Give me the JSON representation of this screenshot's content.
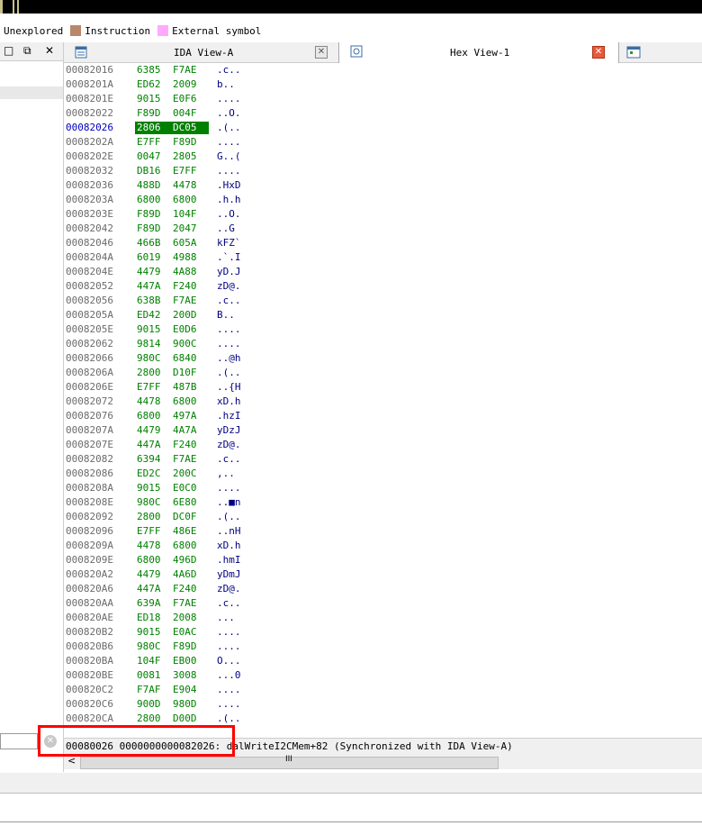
{
  "legend": [
    {
      "label": "Unexplored",
      "color": ""
    },
    {
      "label": "Instruction",
      "color": "#b9876a"
    },
    {
      "label": "External symbol",
      "color": "#ffaaff"
    }
  ],
  "left_panel": {
    "icons": [
      "restore-icon",
      "float-icon",
      "close-icon"
    ]
  },
  "tabs": [
    {
      "label": "IDA View-A",
      "active": false
    },
    {
      "label": "Hex View-1",
      "active": true
    }
  ],
  "hex_rows": [
    {
      "addr": "00082016",
      "h1": "6385",
      "h2": "F7AE",
      "ascii": ".c.."
    },
    {
      "addr": "0008201A",
      "h1": "ED62",
      "h2": "2009",
      "ascii": "b.."
    },
    {
      "addr": "0008201E",
      "h1": "9015",
      "h2": "E0F6",
      "ascii": "...."
    },
    {
      "addr": "00082022",
      "h1": "F89D",
      "h2": "004F",
      "ascii": "..O."
    },
    {
      "addr": "00082026",
      "h1": "2806",
      "h2": "DC05",
      "ascii": ".(..",
      "current": true
    },
    {
      "addr": "0008202A",
      "h1": "E7FF",
      "h2": "F89D",
      "ascii": "...."
    },
    {
      "addr": "0008202E",
      "h1": "0047",
      "h2": "2805",
      "ascii": "G..("
    },
    {
      "addr": "00082032",
      "h1": "DB16",
      "h2": "E7FF",
      "ascii": "...."
    },
    {
      "addr": "00082036",
      "h1": "488D",
      "h2": "4478",
      "ascii": ".HxD"
    },
    {
      "addr": "0008203A",
      "h1": "6800",
      "h2": "6800",
      "ascii": ".h.h"
    },
    {
      "addr": "0008203E",
      "h1": "F89D",
      "h2": "104F",
      "ascii": "..O."
    },
    {
      "addr": "00082042",
      "h1": "F89D",
      "h2": "2047",
      "ascii": "..G"
    },
    {
      "addr": "00082046",
      "h1": "466B",
      "h2": "605A",
      "ascii": "kFZ`"
    },
    {
      "addr": "0008204A",
      "h1": "6019",
      "h2": "4988",
      "ascii": ".`.I"
    },
    {
      "addr": "0008204E",
      "h1": "4479",
      "h2": "4A88",
      "ascii": "yD.J"
    },
    {
      "addr": "00082052",
      "h1": "447A",
      "h2": "F240",
      "ascii": "zD@."
    },
    {
      "addr": "00082056",
      "h1": "638B",
      "h2": "F7AE",
      "ascii": ".c.."
    },
    {
      "addr": "0008205A",
      "h1": "ED42",
      "h2": "200D",
      "ascii": "B.."
    },
    {
      "addr": "0008205E",
      "h1": "9015",
      "h2": "E0D6",
      "ascii": "...."
    },
    {
      "addr": "00082062",
      "h1": "9814",
      "h2": "900C",
      "ascii": "...."
    },
    {
      "addr": "00082066",
      "h1": "980C",
      "h2": "6840",
      "ascii": "..@h"
    },
    {
      "addr": "0008206A",
      "h1": "2800",
      "h2": "D10F",
      "ascii": ".(.."
    },
    {
      "addr": "0008206E",
      "h1": "E7FF",
      "h2": "487B",
      "ascii": "..{H"
    },
    {
      "addr": "00082072",
      "h1": "4478",
      "h2": "6800",
      "ascii": "xD.h"
    },
    {
      "addr": "00082076",
      "h1": "6800",
      "h2": "497A",
      "ascii": ".hzI"
    },
    {
      "addr": "0008207A",
      "h1": "4479",
      "h2": "4A7A",
      "ascii": "yDzJ"
    },
    {
      "addr": "0008207E",
      "h1": "447A",
      "h2": "F240",
      "ascii": "zD@."
    },
    {
      "addr": "00082082",
      "h1": "6394",
      "h2": "F7AE",
      "ascii": ".c.."
    },
    {
      "addr": "00082086",
      "h1": "ED2C",
      "h2": "200C",
      "ascii": ",.."
    },
    {
      "addr": "0008208A",
      "h1": "9015",
      "h2": "E0C0",
      "ascii": "...."
    },
    {
      "addr": "0008208E",
      "h1": "980C",
      "h2": "6E80",
      "ascii": "..■n"
    },
    {
      "addr": "00082092",
      "h1": "2800",
      "h2": "DC0F",
      "ascii": ".(.."
    },
    {
      "addr": "00082096",
      "h1": "E7FF",
      "h2": "486E",
      "ascii": "..nH"
    },
    {
      "addr": "0008209A",
      "h1": "4478",
      "h2": "6800",
      "ascii": "xD.h"
    },
    {
      "addr": "0008209E",
      "h1": "6800",
      "h2": "496D",
      "ascii": ".hmI"
    },
    {
      "addr": "000820A2",
      "h1": "4479",
      "h2": "4A6D",
      "ascii": "yDmJ"
    },
    {
      "addr": "000820A6",
      "h1": "447A",
      "h2": "F240",
      "ascii": "zD@."
    },
    {
      "addr": "000820AA",
      "h1": "639A",
      "h2": "F7AE",
      "ascii": ".c.."
    },
    {
      "addr": "000820AE",
      "h1": "ED18",
      "h2": "2008",
      "ascii": "..."
    },
    {
      "addr": "000820B2",
      "h1": "9015",
      "h2": "E0AC",
      "ascii": "...."
    },
    {
      "addr": "000820B6",
      "h1": "980C",
      "h2": "F89D",
      "ascii": "...."
    },
    {
      "addr": "000820BA",
      "h1": "104F",
      "h2": "EB00",
      "ascii": "O..."
    },
    {
      "addr": "000820BE",
      "h1": "0081",
      "h2": "3008",
      "ascii": "...0"
    },
    {
      "addr": "000820C2",
      "h1": "F7AF",
      "h2": "E904",
      "ascii": "...."
    },
    {
      "addr": "000820C6",
      "h1": "900D",
      "h2": "980D",
      "ascii": "...."
    },
    {
      "addr": "000820CA",
      "h1": "2800",
      "h2": "D00D",
      "ascii": ".(.."
    }
  ],
  "status": {
    "text": "00080026 0000000000082026: dalWriteI2CMem+82 (Synchronized with IDA View-A)"
  },
  "scrollbar": {
    "grip": "III",
    "left_arrow": "<"
  }
}
